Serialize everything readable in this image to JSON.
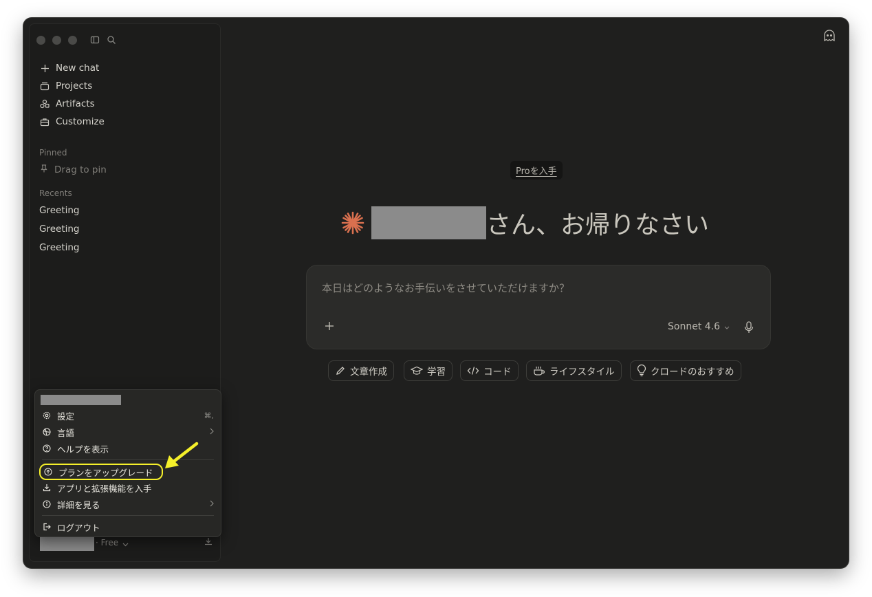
{
  "sidebar": {
    "nav": [
      {
        "label": "New chat",
        "icon": "plus-icon"
      },
      {
        "label": "Projects",
        "icon": "folder-icon"
      },
      {
        "label": "Artifacts",
        "icon": "artifacts-icon"
      },
      {
        "label": "Customize",
        "icon": "briefcase-icon"
      }
    ],
    "pinned_label": "Pinned",
    "drag_to_pin": "Drag to pin",
    "recents_label": "Recents",
    "recents": [
      "Greeting",
      "Greeting",
      "Greeting"
    ]
  },
  "account_menu": {
    "items": [
      {
        "label": "設定",
        "shortcut": "⌘,",
        "icon": "gear-icon"
      },
      {
        "label": "言語",
        "icon": "globe-icon"
      },
      {
        "label": "ヘルプを表示",
        "icon": "help-icon"
      },
      {
        "label": "プランをアップグレード",
        "icon": "upgrade-icon"
      },
      {
        "label": "アプリと拡張機能を入手",
        "icon": "download-icon"
      },
      {
        "label": "詳細を見る",
        "icon": "info-icon"
      },
      {
        "label": "ログアウト",
        "icon": "logout-icon"
      }
    ]
  },
  "footer": {
    "plan": "· Free"
  },
  "main": {
    "pro_badge": "Proを入手",
    "greeting_suffix": "さん、お帰りなさい",
    "input_placeholder": "本日はどのようなお手伝いをさせていただけますか？",
    "model": "Sonnet 4.6",
    "chips": [
      {
        "label": "文章作成",
        "icon": "pencil-icon"
      },
      {
        "label": "学習",
        "icon": "graduation-cap-icon"
      },
      {
        "label": "コード",
        "icon": "code-icon"
      },
      {
        "label": "ライフスタイル",
        "icon": "coffee-icon"
      },
      {
        "label": "クロードのおすすめ",
        "icon": "lightbulb-icon"
      }
    ]
  },
  "colors": {
    "accent_star": "#d9704f",
    "highlight": "#f5f02a",
    "background": "#1f1f1e"
  }
}
